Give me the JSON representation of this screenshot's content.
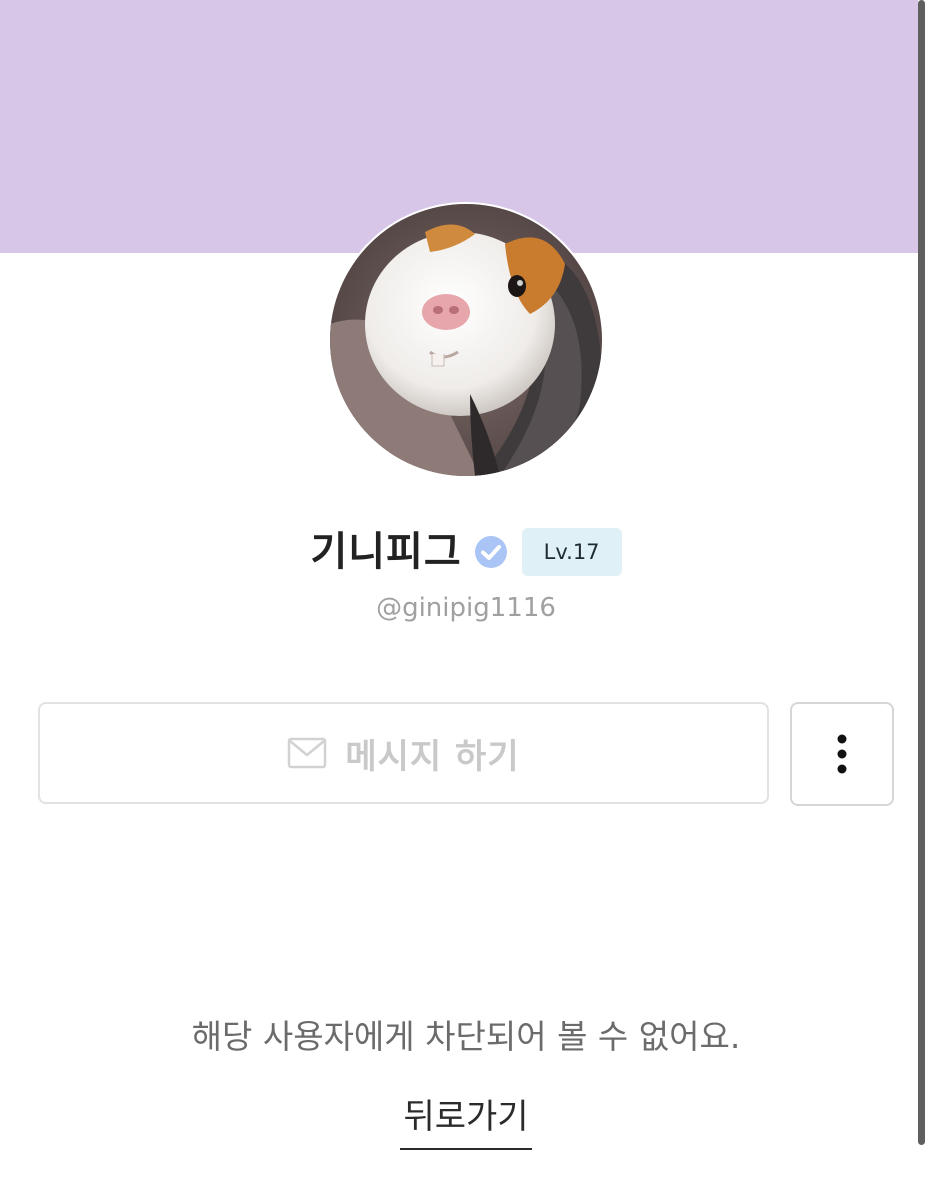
{
  "profile": {
    "name": "기니피그",
    "level": "Lv.17",
    "handle": "@ginipig1116",
    "verified_icon": "verified-check-icon",
    "avatar_subject": "guinea pig photo"
  },
  "actions": {
    "message_label": "메시지 하기",
    "message_icon": "mail-icon",
    "more_icon": "more-vertical-icon"
  },
  "status": {
    "blocked_message": "해당 사용자에게 차단되어 볼 수 없어요.",
    "back_label": "뒤로가기"
  },
  "colors": {
    "cover": "#d8c6e8",
    "level_badge": "#dff1f7",
    "verified": "#a9c4f5"
  }
}
